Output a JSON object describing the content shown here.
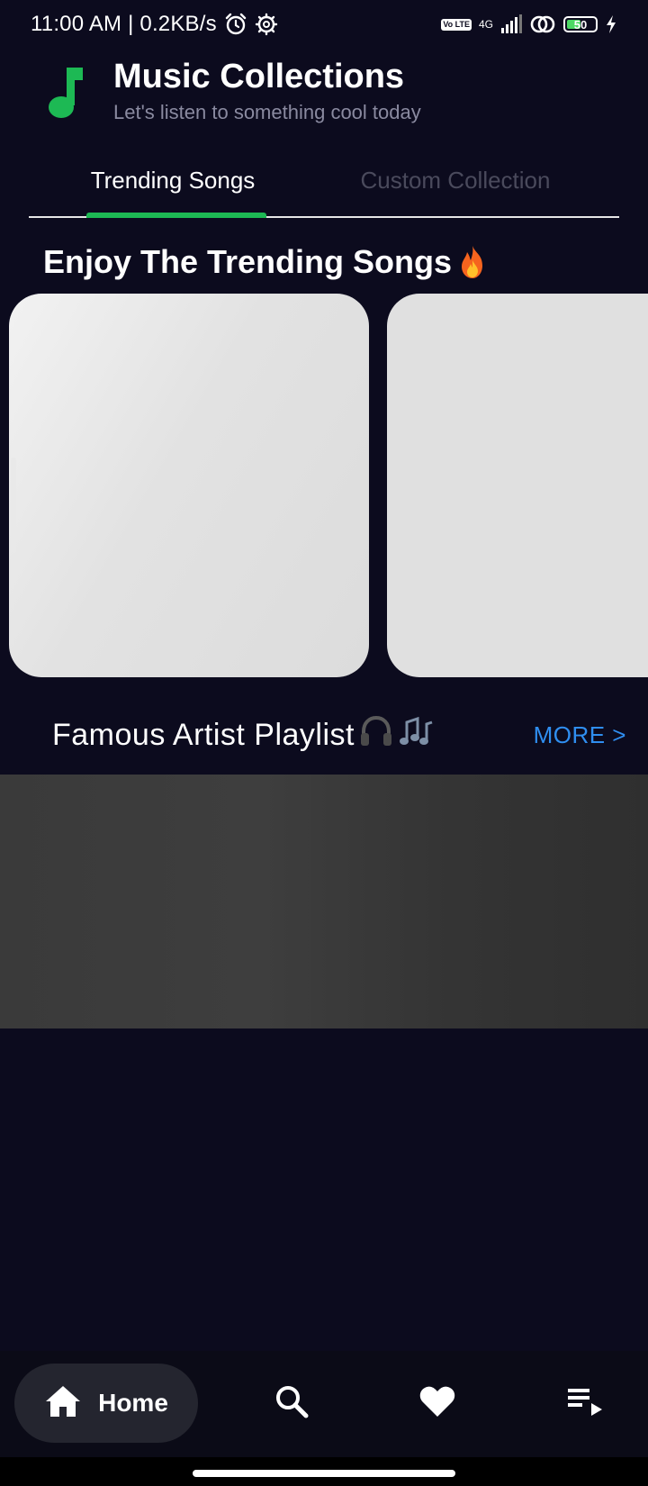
{
  "status_bar": {
    "time_speed": "11:00 AM | 0.2KB/s",
    "network": "4G",
    "lte": "Vo LTE",
    "battery": "50",
    "battery_level_percent": 50
  },
  "header": {
    "title": "Music Collections",
    "subtitle": "Let's listen to something cool today",
    "logo_icon": "music-note-icon",
    "accent_color": "#1db954"
  },
  "tabs": [
    {
      "label": "Trending Songs",
      "active": true
    },
    {
      "label": "Custom Collection",
      "active": false
    }
  ],
  "trending": {
    "title": "Enjoy The Trending Songs",
    "title_icon": "fire-icon"
  },
  "artists": {
    "title": "Famous Artist Playlist",
    "title_icons": [
      "headphones-icon",
      "music-notes-icon"
    ],
    "more_label": "MORE >",
    "more_color": "#2f8ef0"
  },
  "bottom_nav": {
    "home_label": "Home",
    "items": [
      "home-icon",
      "search-icon",
      "heart-icon",
      "playlist-play-icon"
    ]
  },
  "colors": {
    "background": "#0c0b1e",
    "active_tab": "#ffffff",
    "inactive_tab": "#4a4a5c",
    "tab_indicator": "#1db954"
  }
}
